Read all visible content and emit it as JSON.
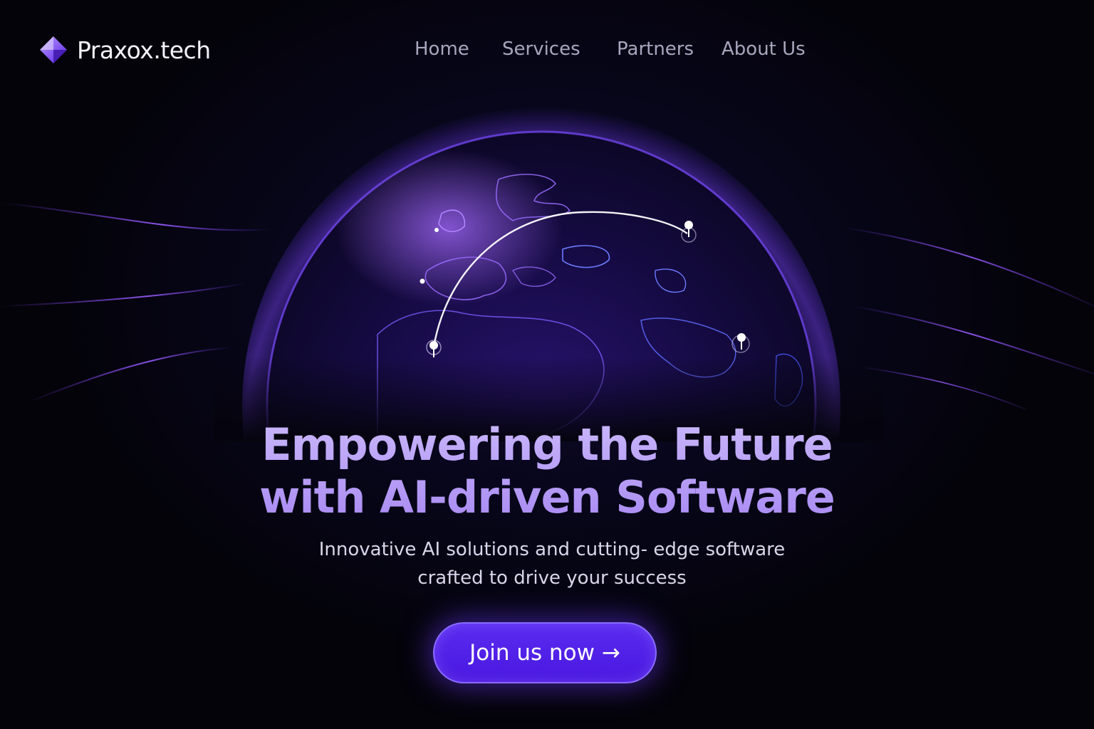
{
  "brand": {
    "name": "Praxox.tech",
    "icon": "diamond-logo-icon"
  },
  "nav": {
    "items": [
      {
        "label": "Home"
      },
      {
        "label": "Services"
      },
      {
        "label": "Partners"
      },
      {
        "label": "About Us"
      }
    ]
  },
  "hero": {
    "headline_line1": "Empowering the Future",
    "headline_line2": "with AI-driven Software",
    "subtext_line1": "Innovative AI solutions and cutting- edge software",
    "subtext_line2": "crafted to drive your success",
    "cta_label": "Join us now →"
  },
  "colors": {
    "background": "#05040d",
    "accent": "#5a2cf0",
    "headline": "#b49cf6",
    "nav_text": "#a8a6bd"
  }
}
